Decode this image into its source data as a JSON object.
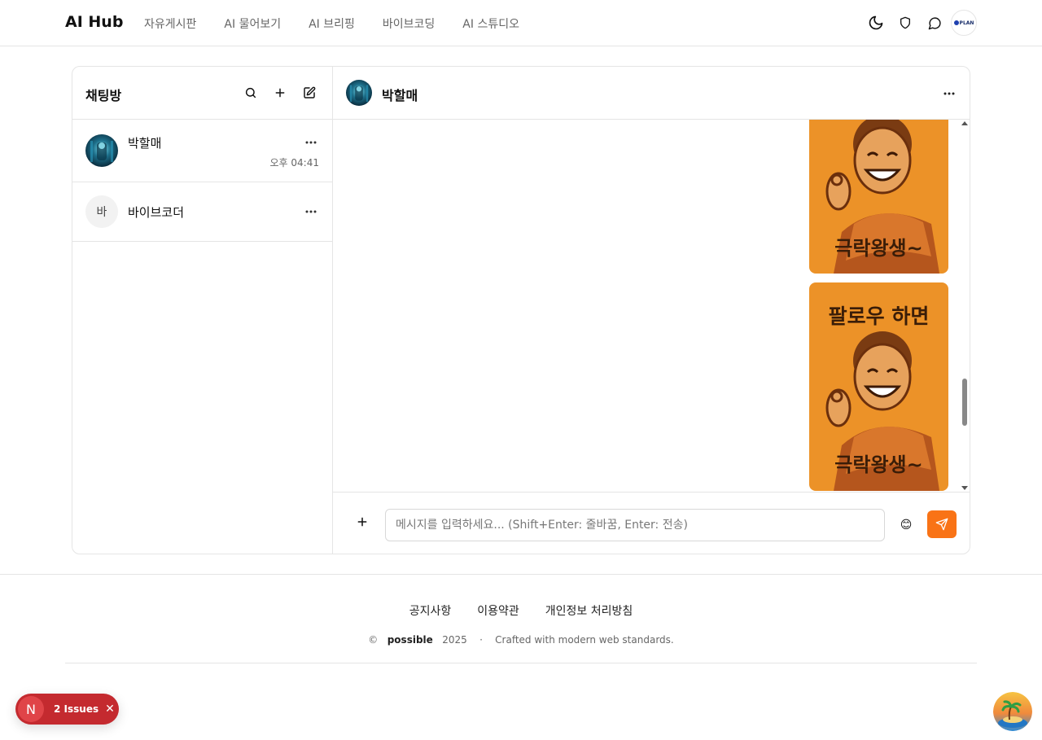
{
  "header": {
    "logo": "AI Hub",
    "nav": [
      "자유게시판",
      "AI 물어보기",
      "AI 브리핑",
      "바이브코딩",
      "AI 스튜디오"
    ],
    "profile_text": "PLAN"
  },
  "sidebar": {
    "title": "채팅방",
    "rooms": [
      {
        "name": "박할매",
        "time": "오후 04:41"
      },
      {
        "name": "바이브코더",
        "initial": "바"
      }
    ]
  },
  "chat": {
    "partner": "박할매",
    "sticker_top_text": "팔로우 하면",
    "sticker_bottom_text": "극락왕생~",
    "input_placeholder": "메시지를 입력하세요... (Shift+Enter: 줄바꿈, Enter: 전송)",
    "emoji_glyph": "😊"
  },
  "footer": {
    "links": [
      "공지사항",
      "이용약관",
      "개인정보 처리방침"
    ],
    "copyright_symbol": "©",
    "brand": "possible",
    "year": "2025",
    "separator": "·",
    "tagline": "Crafted with modern web standards."
  },
  "issues_badge": {
    "letter": "N",
    "label": "2 Issues",
    "close": "✕"
  },
  "colors": {
    "accent": "#f97316",
    "sticker_bg": "#ec9228",
    "issues_bg": "#c42a2f"
  }
}
